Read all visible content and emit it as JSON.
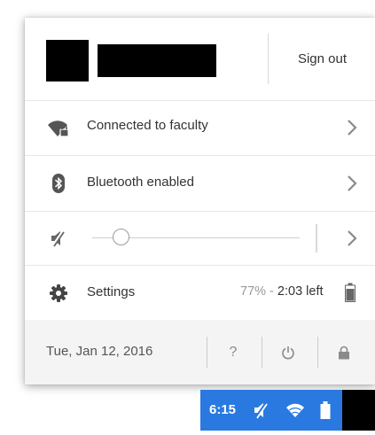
{
  "header": {
    "sign_out_label": "Sign out"
  },
  "network": {
    "label": "Connected to faculty",
    "icon": "wifi-locked-icon"
  },
  "bluetooth": {
    "label": "Bluetooth enabled",
    "icon": "bluetooth-icon"
  },
  "volume": {
    "icon": "volume-muted-icon",
    "level": 0.1
  },
  "settings": {
    "label": "Settings",
    "icon": "gear-icon",
    "battery_percent": "77%",
    "battery_separator": " - ",
    "battery_time_left": "2:03 left"
  },
  "footer": {
    "date": "Tue, Jan 12, 2016",
    "help_label": "?"
  },
  "status_area": {
    "time": "6:15",
    "background_color": "#2979e0"
  }
}
